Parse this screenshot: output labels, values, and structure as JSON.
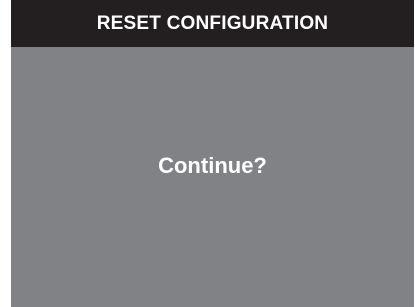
{
  "dialog": {
    "title": "RESET CONFIGURATION",
    "prompt": "Continue?"
  },
  "colors": {
    "title_bar_background": "#231f20",
    "screen_background": "#818285",
    "text": "#ffffff"
  }
}
